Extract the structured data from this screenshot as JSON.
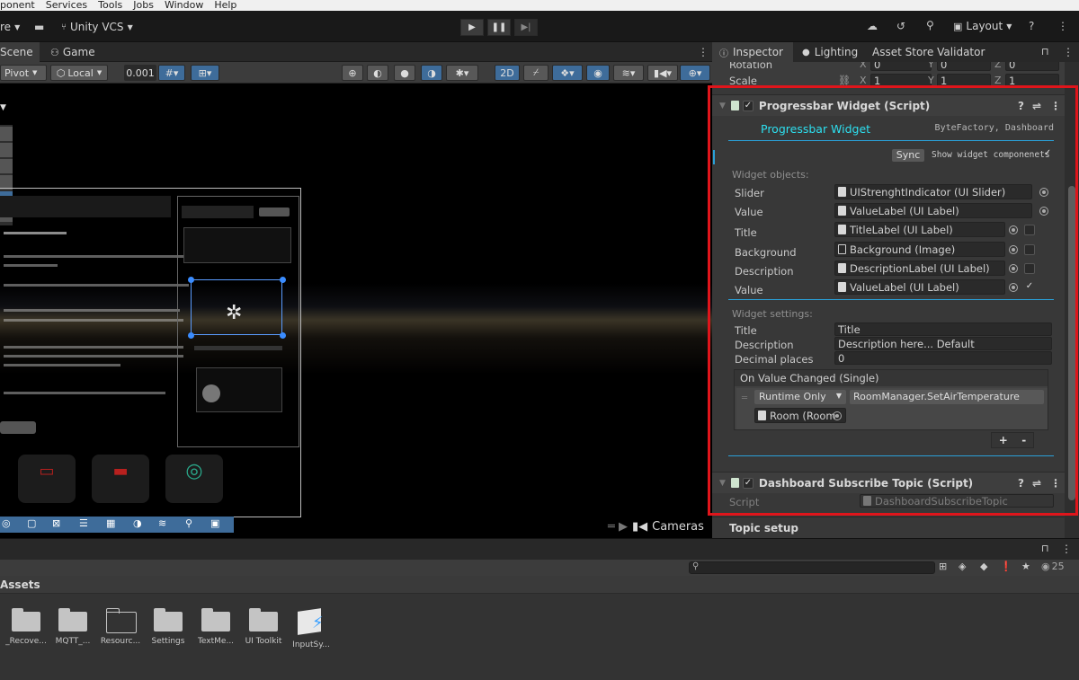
{
  "menu": [
    "ponent",
    "Services",
    "Tools",
    "Jobs",
    "Window",
    "Help"
  ],
  "toolbar": {
    "left_cut": "re",
    "vcs_label": "Unity VCS",
    "layout_label": "Layout",
    "colors": {
      "bg": "#191919",
      "accent_cyan": "#2de0f0",
      "selection_red": "#e0151b"
    }
  },
  "scene": {
    "tabs": [
      "Scene",
      "Game"
    ],
    "pivot": "Pivot",
    "local": "Local",
    "snap_value": "0.001",
    "mode_2d": "2D",
    "cameras": "Cameras"
  },
  "inspector": {
    "tabs": [
      "Inspector",
      "Lighting",
      "Asset Store Validator"
    ],
    "transform": {
      "rotation_label": "Rotation",
      "scale_label": "Scale",
      "rotation": {
        "x": "0",
        "y": "0",
        "z": "0"
      },
      "scale": {
        "x": "1",
        "y": "1",
        "z": "1"
      }
    },
    "progress": {
      "component_title": "Progressbar Widget (Script)",
      "widget_name": "Progressbar Widget",
      "vendor": "ByteFactory, Dashboard",
      "sync_btn": "Sync",
      "show_components": "Show widget componenets",
      "objects_header": "Widget objects:",
      "objects": [
        {
          "label": "Slider",
          "value": "UIStrenghtIndicator (UI Slider)"
        },
        {
          "label": "Value",
          "value": "ValueLabel (UI Label)"
        },
        {
          "label": "Title",
          "value": "TitleLabel (UI Label)"
        },
        {
          "label": "Background",
          "value": "Background (Image)"
        },
        {
          "label": "Description",
          "value": "DescriptionLabel (UI Label)"
        },
        {
          "label": "Value",
          "value": "ValueLabel (UI Label)"
        }
      ],
      "settings_header": "Widget settings:",
      "settings": [
        {
          "label": "Title",
          "value": "Title"
        },
        {
          "label": "Description",
          "value": "Description here... Default"
        },
        {
          "label": "Decimal places",
          "value": "0"
        }
      ],
      "event_title": "On Value Changed (Single)",
      "event_mode": "Runtime Only",
      "event_function": "RoomManager.SetAirTemperature",
      "event_target": "Room (Room",
      "plus": "+",
      "minus": "-"
    },
    "subscribe": {
      "component_title": "Dashboard Subscribe Topic (Script)",
      "script_label": "Script",
      "script_value": "DashboardSubscribeTopic",
      "topic_setup": "Topic setup"
    }
  },
  "project": {
    "assets_label": "Assets",
    "count": "25",
    "items": [
      "_Recove...",
      "MQTT_...",
      "Resourc...",
      "Settings",
      "TextMe...",
      "UI Toolkit",
      "InputSy..."
    ]
  }
}
